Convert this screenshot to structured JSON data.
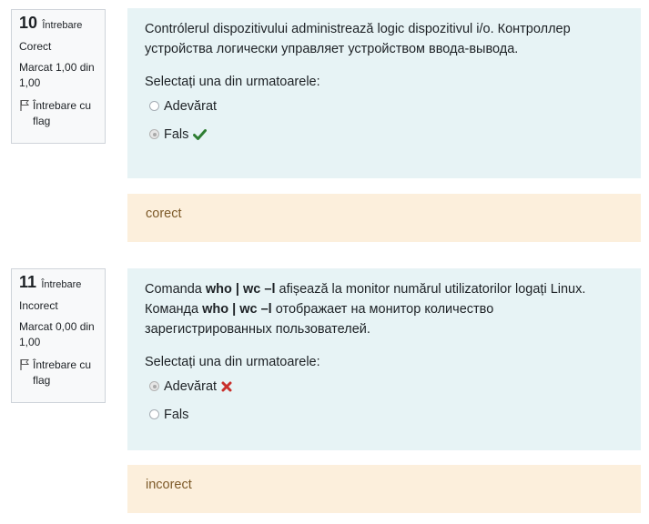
{
  "questions": [
    {
      "number": "10",
      "label": "Întrebare",
      "state": "Corect",
      "marks": "Marcat 1,00 din 1,00",
      "flag_label": "Întrebare cu flag",
      "text_parts": [
        "Contrólerul dispozitivului administrează logic dispozitivul i/o.   Контроллер устройства логически управляет устройством ввода-вывода."
      ],
      "prompt": "Selectați una din urmatoarele:",
      "options": [
        {
          "label": "Adevărat",
          "selected": false,
          "mark": null
        },
        {
          "label": "Fals",
          "selected": true,
          "mark": "correct"
        }
      ],
      "feedback": "corect"
    },
    {
      "number": "11",
      "label": "Întrebare",
      "state": "Incorect",
      "marks": "Marcat 0,00 din 1,00",
      "flag_label": "Întrebare cu flag",
      "text_parts": [
        "Comanda ",
        "who | wc –l",
        "  afișează la monitor numărul utilizatorilor logați Linux.   Команда ",
        "who | wc –l",
        " отображает на монитор количество зарегистрированных пользователей."
      ],
      "prompt": "Selectați una din urmatoarele:",
      "options": [
        {
          "label": "Adevărat",
          "selected": true,
          "mark": "incorrect"
        },
        {
          "label": "Fals",
          "selected": false,
          "mark": null
        }
      ],
      "feedback": "incorect"
    }
  ],
  "colors": {
    "correct": "#2e7d32",
    "incorrect": "#c9302c",
    "formulation_bg": "#e7f3f5",
    "feedback_bg": "#fcefdc"
  }
}
